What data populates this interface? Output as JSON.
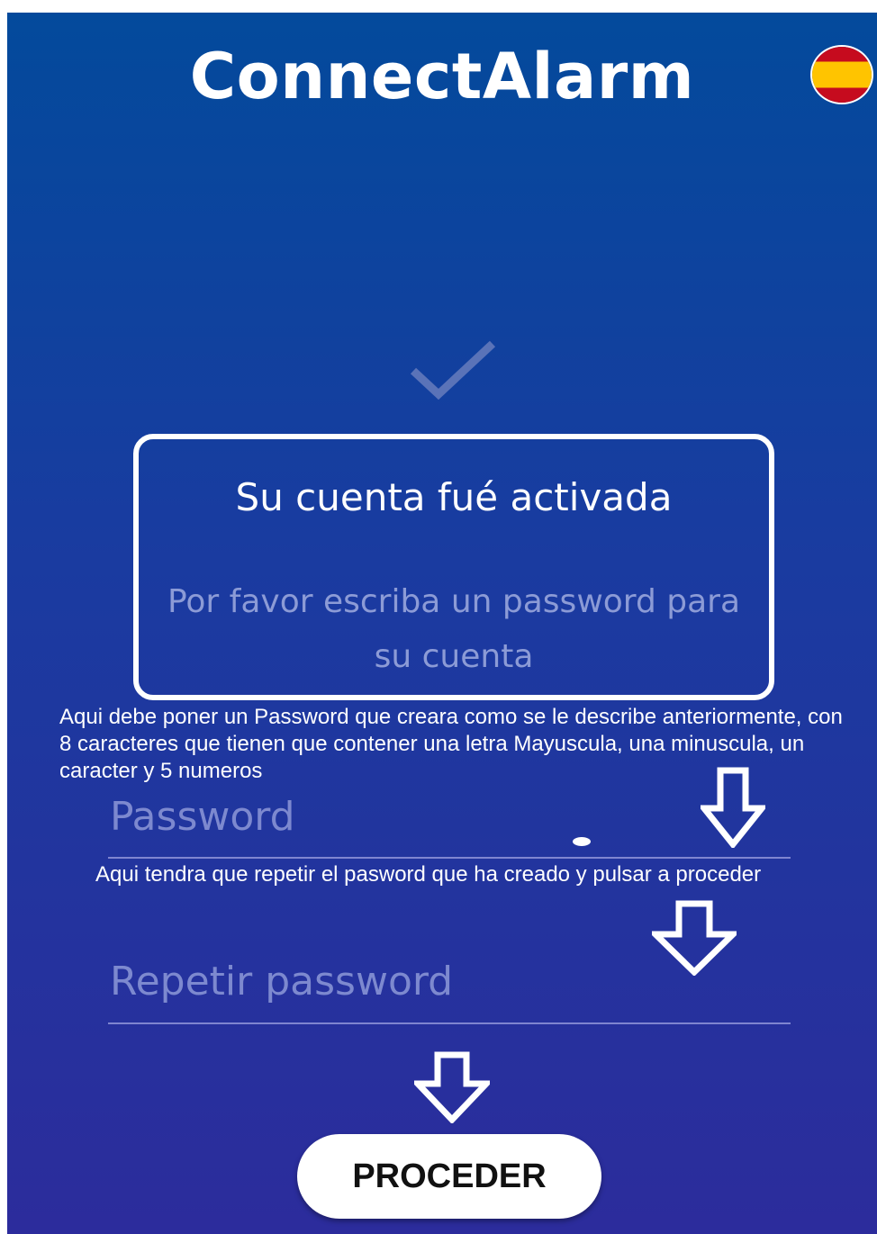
{
  "app": {
    "title": "ConnectAlarm",
    "language_flag": "flag-spain-icon"
  },
  "activation": {
    "heading": "Su cuenta fué activada",
    "instruction": "Por favor escriba un password para su cuenta"
  },
  "annotations": {
    "password_note": "Aqui debe poner un Password que creara como se le describe anteriormente, con 8 caracteres que tienen que contener una letra Mayuscula, una minuscula, un caracter y 5 numeros",
    "repeat_note": "Aqui tendra que repetir el pasword que ha creado y pulsar a proceder"
  },
  "form": {
    "password_placeholder": "Password",
    "password_value": "",
    "repeat_placeholder": "Repetir password",
    "repeat_value": "",
    "submit_label": "PROCEDER"
  },
  "colors": {
    "background_top": "#034a9c",
    "background_bottom": "#2c2c9c",
    "muted_text": "#8c9bd6",
    "flag_red": "#c60b1e",
    "flag_yellow": "#ffc400"
  }
}
